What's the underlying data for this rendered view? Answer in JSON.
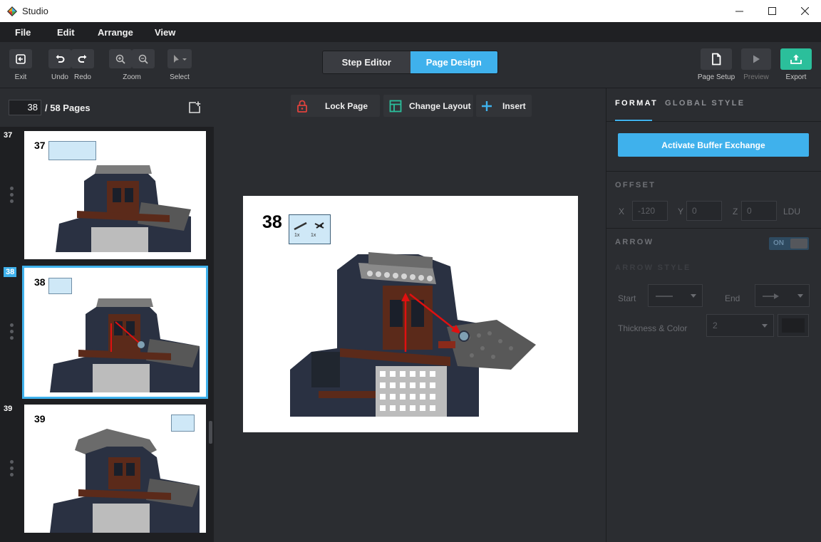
{
  "window": {
    "title": "Studio"
  },
  "menu": [
    "File",
    "Edit",
    "Arrange",
    "View"
  ],
  "toolbar": {
    "exit": "Exit",
    "undo": "Undo",
    "redo": "Redo",
    "zoom": "Zoom",
    "select": "Select",
    "modes": {
      "step_editor": "Step Editor",
      "page_design": "Page Design",
      "active": "Page Design"
    },
    "page_setup": "Page Setup",
    "preview": "Preview",
    "export": "Export"
  },
  "pages": {
    "current": "38",
    "total_label": "/ 58 Pages",
    "thumbnails": [
      {
        "num": "37",
        "selected": false
      },
      {
        "num": "38",
        "selected": true
      },
      {
        "num": "39",
        "selected": false
      }
    ]
  },
  "canvas_tools": {
    "lock": "Lock Page",
    "layout": "Change Layout",
    "insert": "Insert"
  },
  "page_preview": {
    "step": "38",
    "parts": [
      "1x",
      "1x"
    ]
  },
  "format": {
    "tabs": [
      "FORMAT",
      "GLOBAL STYLE"
    ],
    "buffer_button": "Activate Buffer Exchange",
    "offset": {
      "title": "OFFSET",
      "x_label": "X",
      "x": "-120",
      "y_label": "Y",
      "y": "0",
      "z_label": "Z",
      "z": "0",
      "unit": "LDU"
    },
    "arrow": {
      "title": "ARROW",
      "toggle": "ON",
      "style_title": "ARROW STYLE",
      "start_label": "Start",
      "end_label": "End",
      "thickness_label": "Thickness & Color",
      "thickness": "2"
    }
  },
  "colors": {
    "accent": "#3fb1ec",
    "export": "#2bbf9b",
    "arrow": "#e01010"
  }
}
